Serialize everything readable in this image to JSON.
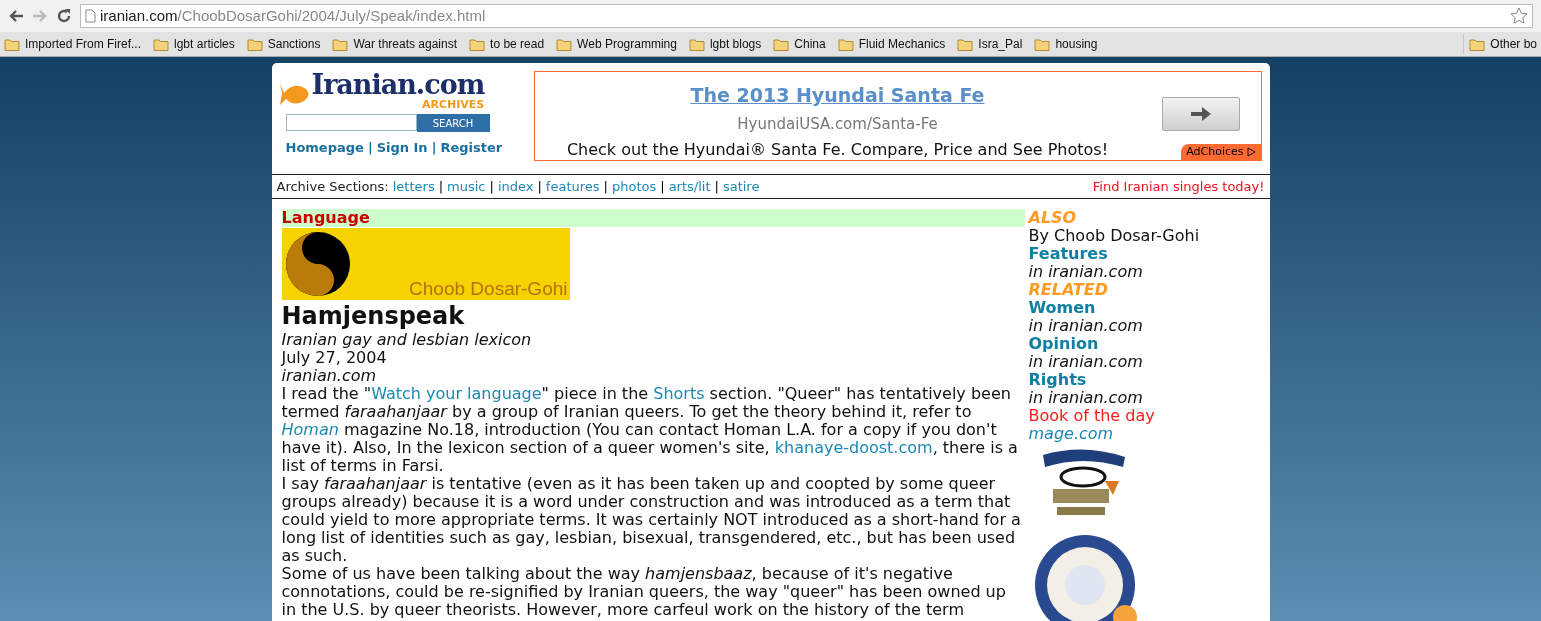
{
  "browser": {
    "url_host": "iranian.com",
    "url_path": "/ChoobDosarGohi/2004/July/Speak/index.html",
    "bookmarks": [
      "Imported From Firef...",
      "lgbt articles",
      "Sanctions",
      "War threats against",
      "to be read",
      "Web Programming",
      "lgbt blogs",
      "China",
      "Fluid Mechanics",
      "Isra_Pal",
      "housing"
    ],
    "other_bookmarks": "Other bo"
  },
  "header": {
    "logo_title": "Iranian.com",
    "logo_subtitle": "ARCHIVES",
    "search_button": "SEARCH",
    "links": [
      "Homepage",
      "Sign In",
      "Register"
    ],
    "separator": "|"
  },
  "ad": {
    "title": "The 2013 Hyundai Santa Fe",
    "url": "HyundaiUSA.com/Santa-Fe",
    "text": "Check out the Hyundai® Santa Fe. Compare, Price and See Photos!",
    "adchoices": "AdChoices"
  },
  "nav": {
    "label": "Archive Sections:",
    "links": [
      "letters",
      "music",
      "index",
      "features",
      "photos",
      "arts/lit",
      "satire"
    ],
    "separator": "|",
    "promo": "Find Iranian singles today!"
  },
  "article": {
    "section": "Language",
    "banner_text": "Choob Dosar-Gohi",
    "title": "Hamjenspeak",
    "subtitle": "Iranian gay and lesbian lexicon",
    "date": "July 27, 2004",
    "source": "iranian.com",
    "paragraphs": [
      [
        {
          "kind": "plain",
          "text": "I read the \""
        },
        {
          "kind": "link",
          "text": "Watch your language"
        },
        {
          "kind": "plain",
          "text": "\" piece in the "
        },
        {
          "kind": "link",
          "text": "Shorts"
        },
        {
          "kind": "plain",
          "text": " section. \"Queer\" has tentatively been termed "
        },
        {
          "kind": "italic",
          "text": "faraahanjaar"
        },
        {
          "kind": "plain",
          "text": " by a group of Iranian queers. To get the theory behind it, refer to "
        },
        {
          "kind": "italic_link",
          "text": "Homan"
        },
        {
          "kind": "plain",
          "text": " magazine No.18, introduction (You can contact Homan L.A. for a copy if you don't have it). Also, In the lexicon section of a queer women's site, "
        },
        {
          "kind": "link",
          "text": "khanaye-doost.com"
        },
        {
          "kind": "plain",
          "text": ", there is a list of terms in Farsi."
        }
      ],
      [
        {
          "kind": "plain",
          "text": "I say "
        },
        {
          "kind": "italic",
          "text": "faraahanjaar"
        },
        {
          "kind": "plain",
          "text": " is tentative (even as it has been taken up and coopted by some queer groups already) because it is a word under construction and was introduced as a term that could yield to more appropriate terms. It was certainly NOT introduced as a short-hand for a long list of identities such as gay, lesbian, bisexual, transgendered, etc., but has been used as such."
        }
      ],
      [
        {
          "kind": "plain",
          "text": "Some of us have been talking about the way "
        },
        {
          "kind": "italic",
          "text": "hamjensbaaz"
        },
        {
          "kind": "plain",
          "text": ", because of it's negative connotations, could be re-signified by Iranian queers, the way \"queer\" has been owned up in the U.S. by queer theorists. However, more carfeul work on the history of the term"
        }
      ]
    ]
  },
  "sidebar": [
    {
      "kind": "heading",
      "text": "ALSO"
    },
    {
      "kind": "text",
      "text": "By Choob Dosar-Gohi"
    },
    {
      "kind": "link",
      "text": "Features"
    },
    {
      "kind": "source",
      "text": "in iranian.com"
    },
    {
      "kind": "heading",
      "text": "RELATED"
    },
    {
      "kind": "link",
      "text": "Women"
    },
    {
      "kind": "source",
      "text": "in iranian.com"
    },
    {
      "kind": "link",
      "text": "Opinion"
    },
    {
      "kind": "source",
      "text": "in iranian.com"
    },
    {
      "kind": "link",
      "text": "Rights"
    },
    {
      "kind": "source",
      "text": "in iranian.com"
    },
    {
      "kind": "promo",
      "text": "Book of the day"
    },
    {
      "kind": "italic_link",
      "text": "mage.com"
    },
    {
      "kind": "picture"
    }
  ]
}
